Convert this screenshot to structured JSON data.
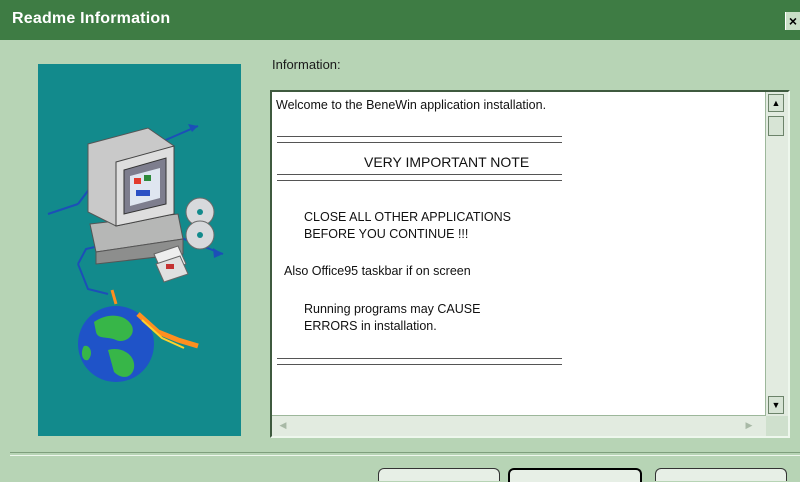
{
  "window": {
    "title": "Readme Information",
    "close_label": "×"
  },
  "info_label": "Information:",
  "readme": {
    "welcome": "Welcome to the BeneWin application installation.",
    "note_heading": "VERY IMPORTANT NOTE",
    "close_line1": "CLOSE ALL OTHER APPLICATIONS",
    "close_line2": "BEFORE YOU CONTINUE !!!",
    "also_line": "Also Office95 taskbar if on screen",
    "running_line1": "Running programs may CAUSE",
    "running_line2": "ERRORS in installation."
  },
  "scrollbar": {
    "up_arrow": "▲",
    "down_arrow": "▼",
    "left_arrow": "◀",
    "right_arrow": "▶"
  },
  "icons": [
    "computer-icon",
    "cd-icon",
    "floppy-icon",
    "globe-icon"
  ]
}
